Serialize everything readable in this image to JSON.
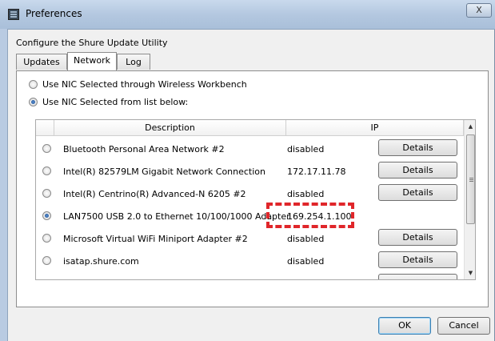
{
  "window": {
    "title": "Preferences",
    "close_label": "X"
  },
  "heading": "Configure the Shure Update Utility",
  "tabs": [
    {
      "label": "Updates",
      "active": false
    },
    {
      "label": "Network",
      "active": true
    },
    {
      "label": "Log",
      "active": false
    }
  ],
  "options": [
    {
      "label": "Use NIC Selected through Wireless Workbench",
      "checked": false
    },
    {
      "label": "Use NIC Selected from list below:",
      "checked": true
    }
  ],
  "table": {
    "columns": [
      "Description",
      "IP"
    ],
    "details_label": "Details",
    "rows": [
      {
        "description": "Bluetooth Personal Area Network #2",
        "ip": "disabled",
        "selected": false
      },
      {
        "description": "Intel(R) 82579LM Gigabit Network Connection",
        "ip": "172.17.11.78",
        "selected": false
      },
      {
        "description": "Intel(R) Centrino(R) Advanced-N 6205 #2",
        "ip": "disabled",
        "selected": false
      },
      {
        "description": "LAN7500 USB 2.0 to Ethernet 10/100/1000 Adapter",
        "ip": "169.254.1.100",
        "selected": true
      },
      {
        "description": "Microsoft Virtual WiFi Miniport Adapter #2",
        "ip": "disabled",
        "selected": false
      },
      {
        "description": "isatap.shure.com",
        "ip": "disabled",
        "selected": false
      }
    ]
  },
  "icons": {
    "scroll_up": "▲",
    "scroll_down": "▼"
  },
  "colors": {
    "highlight": "#e0262a",
    "radio_selected": "#1d4f91"
  },
  "footer": {
    "ok_label": "OK",
    "cancel_label": "Cancel"
  }
}
